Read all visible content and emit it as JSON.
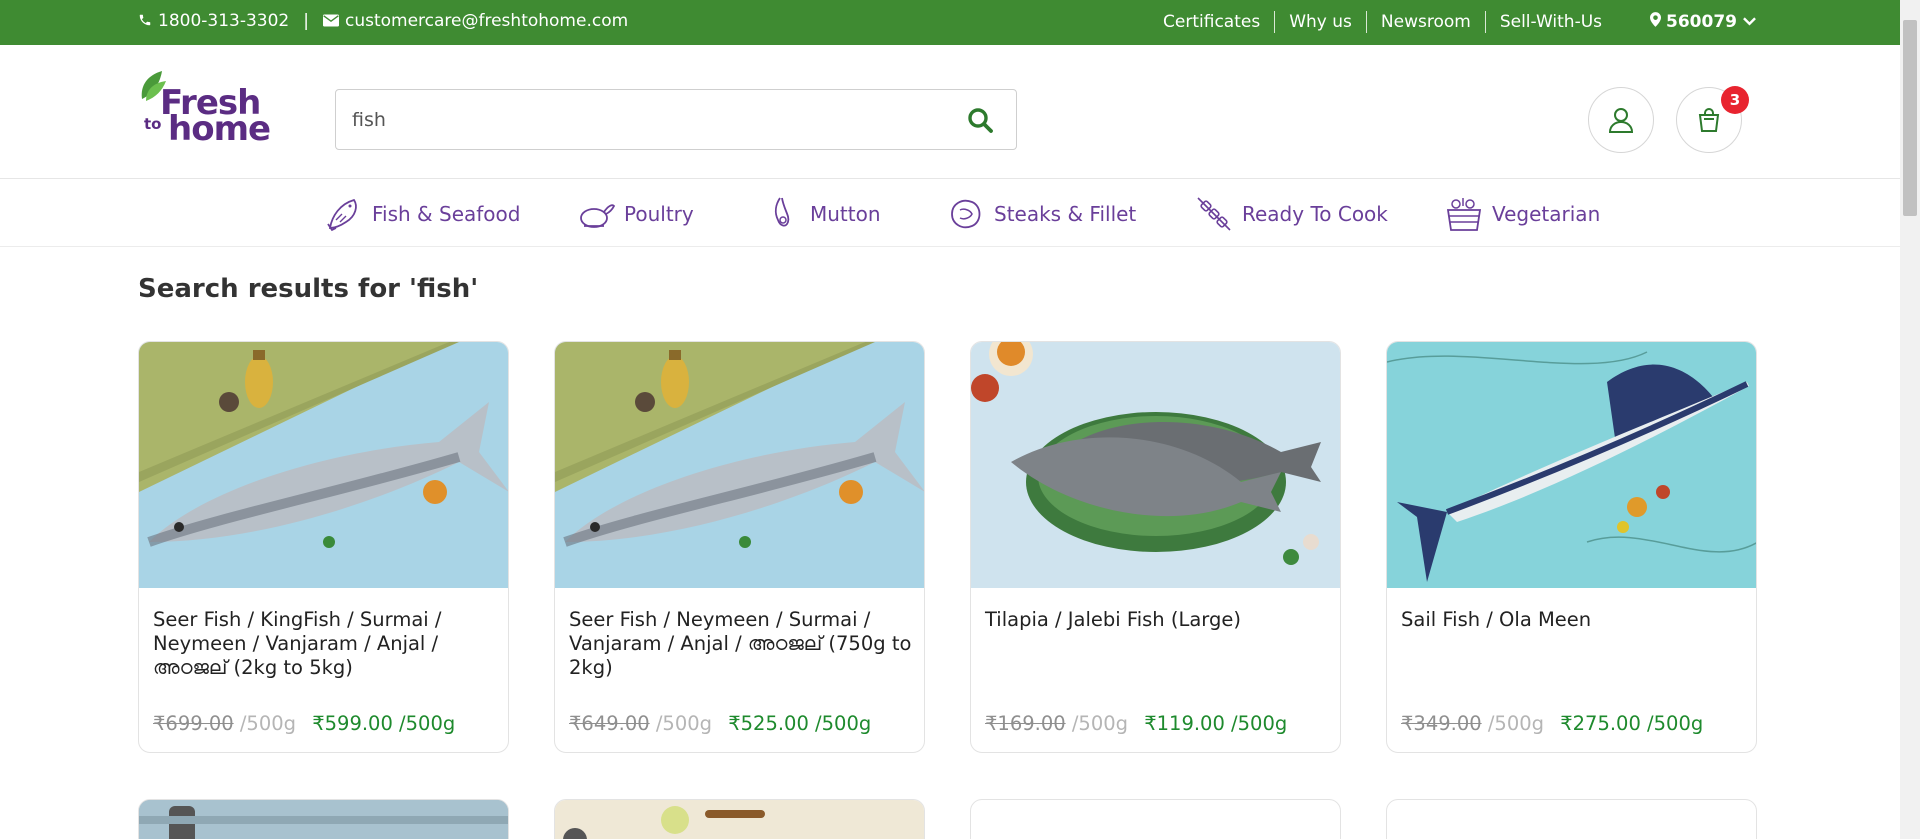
{
  "topbar": {
    "phone": "1800-313-3302",
    "separator": "|",
    "email": "customercare@freshtohome.com",
    "links": [
      "Certificates",
      "Why us",
      "Newsroom",
      "Sell-With-Us"
    ],
    "pincode": "560079"
  },
  "header": {
    "logo": {
      "line1": "Fresh",
      "line2": "to",
      "line3": "home"
    },
    "search": {
      "value": "fish"
    },
    "cart_count": "3"
  },
  "categories": [
    {
      "label": "Fish & Seafood",
      "icon": "fish-icon"
    },
    {
      "label": "Poultry",
      "icon": "chicken-icon"
    },
    {
      "label": "Mutton",
      "icon": "mutton-icon"
    },
    {
      "label": "Steaks & Fillet",
      "icon": "steak-icon"
    },
    {
      "label": "Ready To Cook",
      "icon": "skewer-icon"
    },
    {
      "label": "Vegetarian",
      "icon": "vegetable-basket-icon"
    }
  ],
  "results": {
    "title": "Search results for 'fish'",
    "products": [
      {
        "name": "Seer Fish / KingFish / Surmai / Neymeen / Vanjaram / Anjal / അഠജല് (2kg to 5kg)",
        "mrp": "₹699.00",
        "mrp_unit": " /500g",
        "price": "₹599.00 /500g"
      },
      {
        "name": "Seer Fish / Neymeen / Surmai / Vanjaram / Anjal / അഠജല് (750g to 2kg)",
        "mrp": "₹649.00",
        "mrp_unit": " /500g",
        "price": "₹525.00 /500g"
      },
      {
        "name": "Tilapia / Jalebi Fish (Large)",
        "mrp": "₹169.00",
        "mrp_unit": " /500g",
        "price": "₹119.00 /500g"
      },
      {
        "name": "Sail Fish / Ola Meen",
        "mrp": "₹349.00",
        "mrp_unit": " /500g",
        "price": "₹275.00 /500g"
      }
    ]
  },
  "colors": {
    "brand_green": "#3f8b32",
    "brand_purple": "#5b2c83",
    "price_green": "#1e8a2d",
    "badge_red": "#e8242f"
  }
}
